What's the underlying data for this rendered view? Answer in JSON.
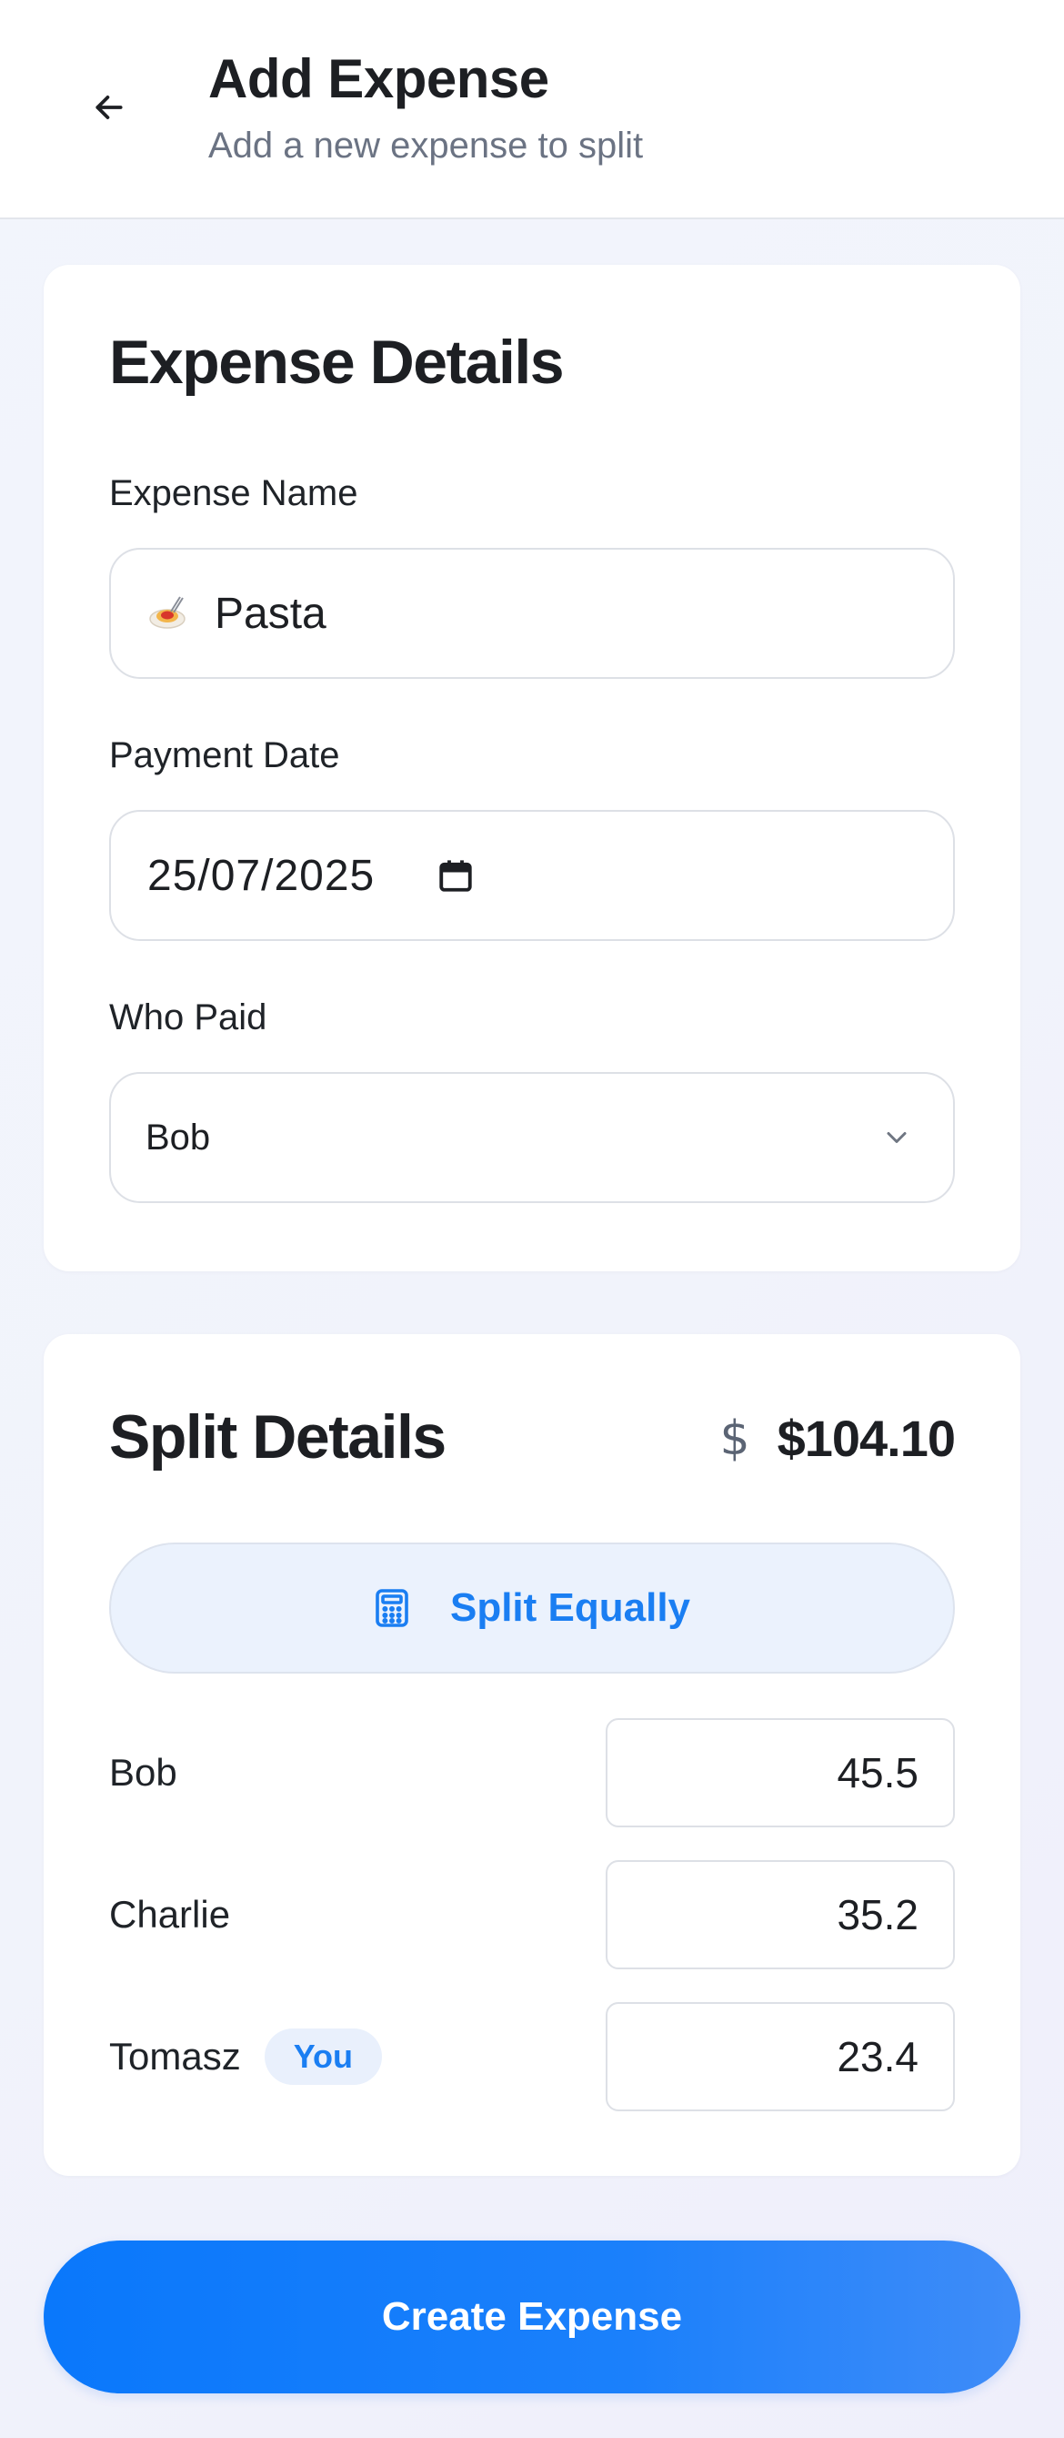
{
  "header": {
    "title": "Add Expense",
    "subtitle": "Add a new expense to split",
    "back_icon": "arrow-left-icon"
  },
  "expense_details": {
    "title": "Expense Details",
    "name_label": "Expense Name",
    "name_emoji_icon": "pasta-emoji-icon",
    "name_value": "Pasta",
    "date_label": "Payment Date",
    "date_value": "25/07/2025",
    "date_icon": "calendar-icon",
    "payer_label": "Who Paid",
    "payer_value": "Bob",
    "payer_icon": "chevron-down-icon"
  },
  "split_details": {
    "title": "Split Details",
    "currency_icon": "dollar-icon",
    "total": "$104.10",
    "split_equally_label": "Split Equally",
    "split_icon": "calculator-icon",
    "participants": [
      {
        "name": "Bob",
        "amount": "45.5"
      },
      {
        "name": "Charlie",
        "amount": "35.2"
      },
      {
        "name": "Tomasz",
        "badge": "You",
        "amount": "23.4"
      }
    ]
  },
  "actions": {
    "create_label": "Create Expense"
  },
  "colors": {
    "accent": "#1a7ef2",
    "button_gradient_start": "#0a78fb",
    "button_gradient_end": "#3f8cf8",
    "badge_bg": "#e9f0fc"
  }
}
